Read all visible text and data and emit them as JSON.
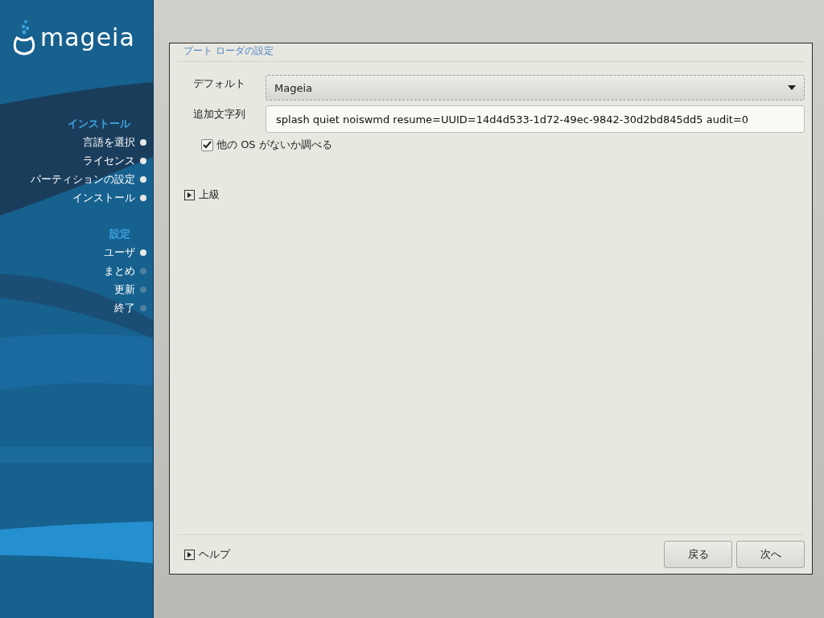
{
  "logo": "mageia",
  "sidebar": {
    "sections": [
      {
        "title": "インストール",
        "steps": [
          {
            "label": "言語を選択",
            "done": true
          },
          {
            "label": "ライセンス",
            "done": true
          },
          {
            "label": "パーティションの設定",
            "done": true
          },
          {
            "label": "インストール",
            "done": true
          }
        ]
      },
      {
        "title": "設定",
        "steps": [
          {
            "label": "ユーザ",
            "done": true
          },
          {
            "label": "まとめ",
            "done": false
          },
          {
            "label": "更新",
            "done": false
          },
          {
            "label": "終了",
            "done": false
          }
        ]
      }
    ]
  },
  "dialog": {
    "title": "ブート ローダの設定",
    "default": {
      "label": "デフォルト",
      "value": "Mageia"
    },
    "append": {
      "label": "追加文字列",
      "value": "splash quiet noiswmd resume=UUID=14d4d533-1d72-49ec-9842-30d2bd845dd5 audit=0"
    },
    "probe_os": {
      "label": "他の OS がないか調べる",
      "checked": true
    },
    "advanced": {
      "label": "上級",
      "expanded": false
    },
    "help": {
      "label": "ヘルプ",
      "expanded": false
    },
    "buttons": [
      "戻る",
      "次へ"
    ]
  }
}
